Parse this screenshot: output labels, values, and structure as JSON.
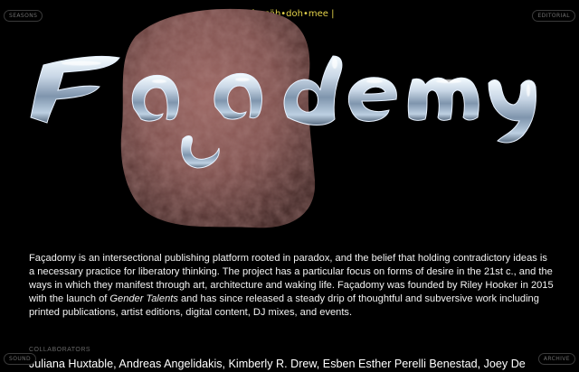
{
  "nav": {
    "seasons": "SEASONS",
    "editorial": "EDITORIAL",
    "sound": "SOUND",
    "archive": "ARCHIVE"
  },
  "header": {
    "pronunciation": "| fa•säh•doh•mee |"
  },
  "logo": {
    "text": "Façadomy",
    "color": "#b8c8dc"
  },
  "intro": {
    "part1": "Façadomy is an intersectional publishing platform rooted in paradox, and the belief that holding contradictory ideas is a necessary practice for liberatory thinking. The project has a particular focus on forms of desire in the 21st c., and the ways in which they manifest through art, architecture and waking life. Façadomy was founded by Riley Hooker in 2015 with the launch of ",
    "italic": "Gender Talents",
    "part2": " and has since released a steady drip of thoughtful and subversive work including printed publications, artist editions, digital content, DJ mixes, and events."
  },
  "collaborators": {
    "heading": "COLLABORATORS",
    "names": "Juliana Huxtable, Andreas Angelidakis, Kimberly R. Drew, Esben Esther Perelli Benestad, Joey De"
  },
  "colors": {
    "background": "#000000",
    "accent": "#e4d24a",
    "flesh": "#7d4f4c"
  }
}
